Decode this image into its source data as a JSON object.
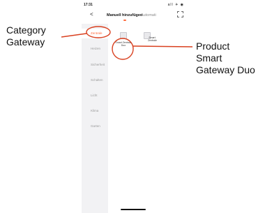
{
  "status_bar": {
    "time": "17:31",
    "icons": "all ✈ ◉"
  },
  "navbar": {
    "back": "<",
    "tab_manual": "Manuell hinzufügen",
    "tab_auto": "Automati",
    "scan_icon": "scan-icon"
  },
  "sidebar": {
    "items": [
      {
        "label": "Zentrale",
        "active": true
      },
      {
        "label": "Heizen"
      },
      {
        "label": "Sicherheit"
      },
      {
        "label": "Schalten"
      },
      {
        "label": "Licht"
      },
      {
        "label": "Klima"
      },
      {
        "label": "Garten"
      }
    ]
  },
  "products": [
    {
      "name": "Smart Zentrale Duo"
    },
    {
      "name": "Smart Zentrale"
    }
  ],
  "annotations": {
    "category": "Category\nGateway",
    "product": "Product\nSmart\nGateway Duo",
    "color": "#d9401f"
  }
}
